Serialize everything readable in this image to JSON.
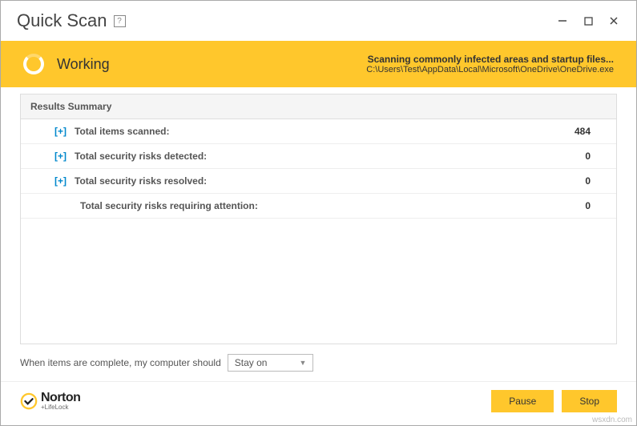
{
  "titlebar": {
    "title": "Quick Scan",
    "help": "?"
  },
  "status": {
    "label": "Working",
    "scan_title": "Scanning commonly infected areas and startup files...",
    "scan_path": "C:\\Users\\Test\\AppData\\Local\\Microsoft\\OneDrive\\OneDrive.exe"
  },
  "results": {
    "header": "Results Summary",
    "expand": "[+]",
    "rows": [
      {
        "label": "Total items scanned:",
        "value": "484",
        "expandable": true
      },
      {
        "label": "Total security risks detected:",
        "value": "0",
        "expandable": true
      },
      {
        "label": "Total security risks resolved:",
        "value": "0",
        "expandable": true
      },
      {
        "label": "Total security risks requiring attention:",
        "value": "0",
        "expandable": false
      }
    ]
  },
  "options": {
    "label": "When items are complete, my computer should",
    "dropdown_value": "Stay on"
  },
  "footer": {
    "logo_name": "Norton",
    "logo_sub": "+LifeLock",
    "pause": "Pause",
    "stop": "Stop"
  },
  "watermark": "wsxdn.com"
}
